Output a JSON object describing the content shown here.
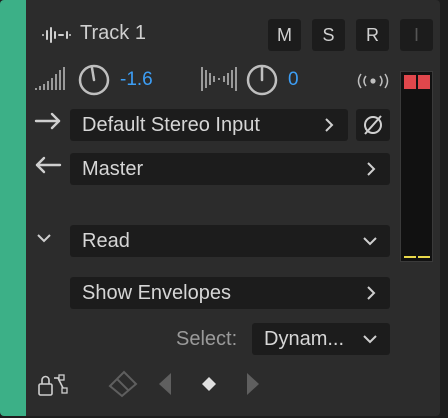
{
  "track": {
    "name": "Track 1",
    "buttons": {
      "mute": "M",
      "solo": "S",
      "record": "R",
      "input": "I"
    }
  },
  "volume": {
    "value": "-1.6"
  },
  "pan": {
    "value": "0"
  },
  "input": {
    "label": "Default Stereo Input"
  },
  "output": {
    "label": "Master"
  },
  "automation": {
    "mode": "Read"
  },
  "envelopes": {
    "label": "Show Envelopes"
  },
  "select": {
    "label": "Select:",
    "value": "Dynam..."
  },
  "colors": {
    "track": "#3cb087",
    "accent": "#3d9ef5",
    "peak": "#e0474c",
    "meter_level": "#e8d84a"
  }
}
